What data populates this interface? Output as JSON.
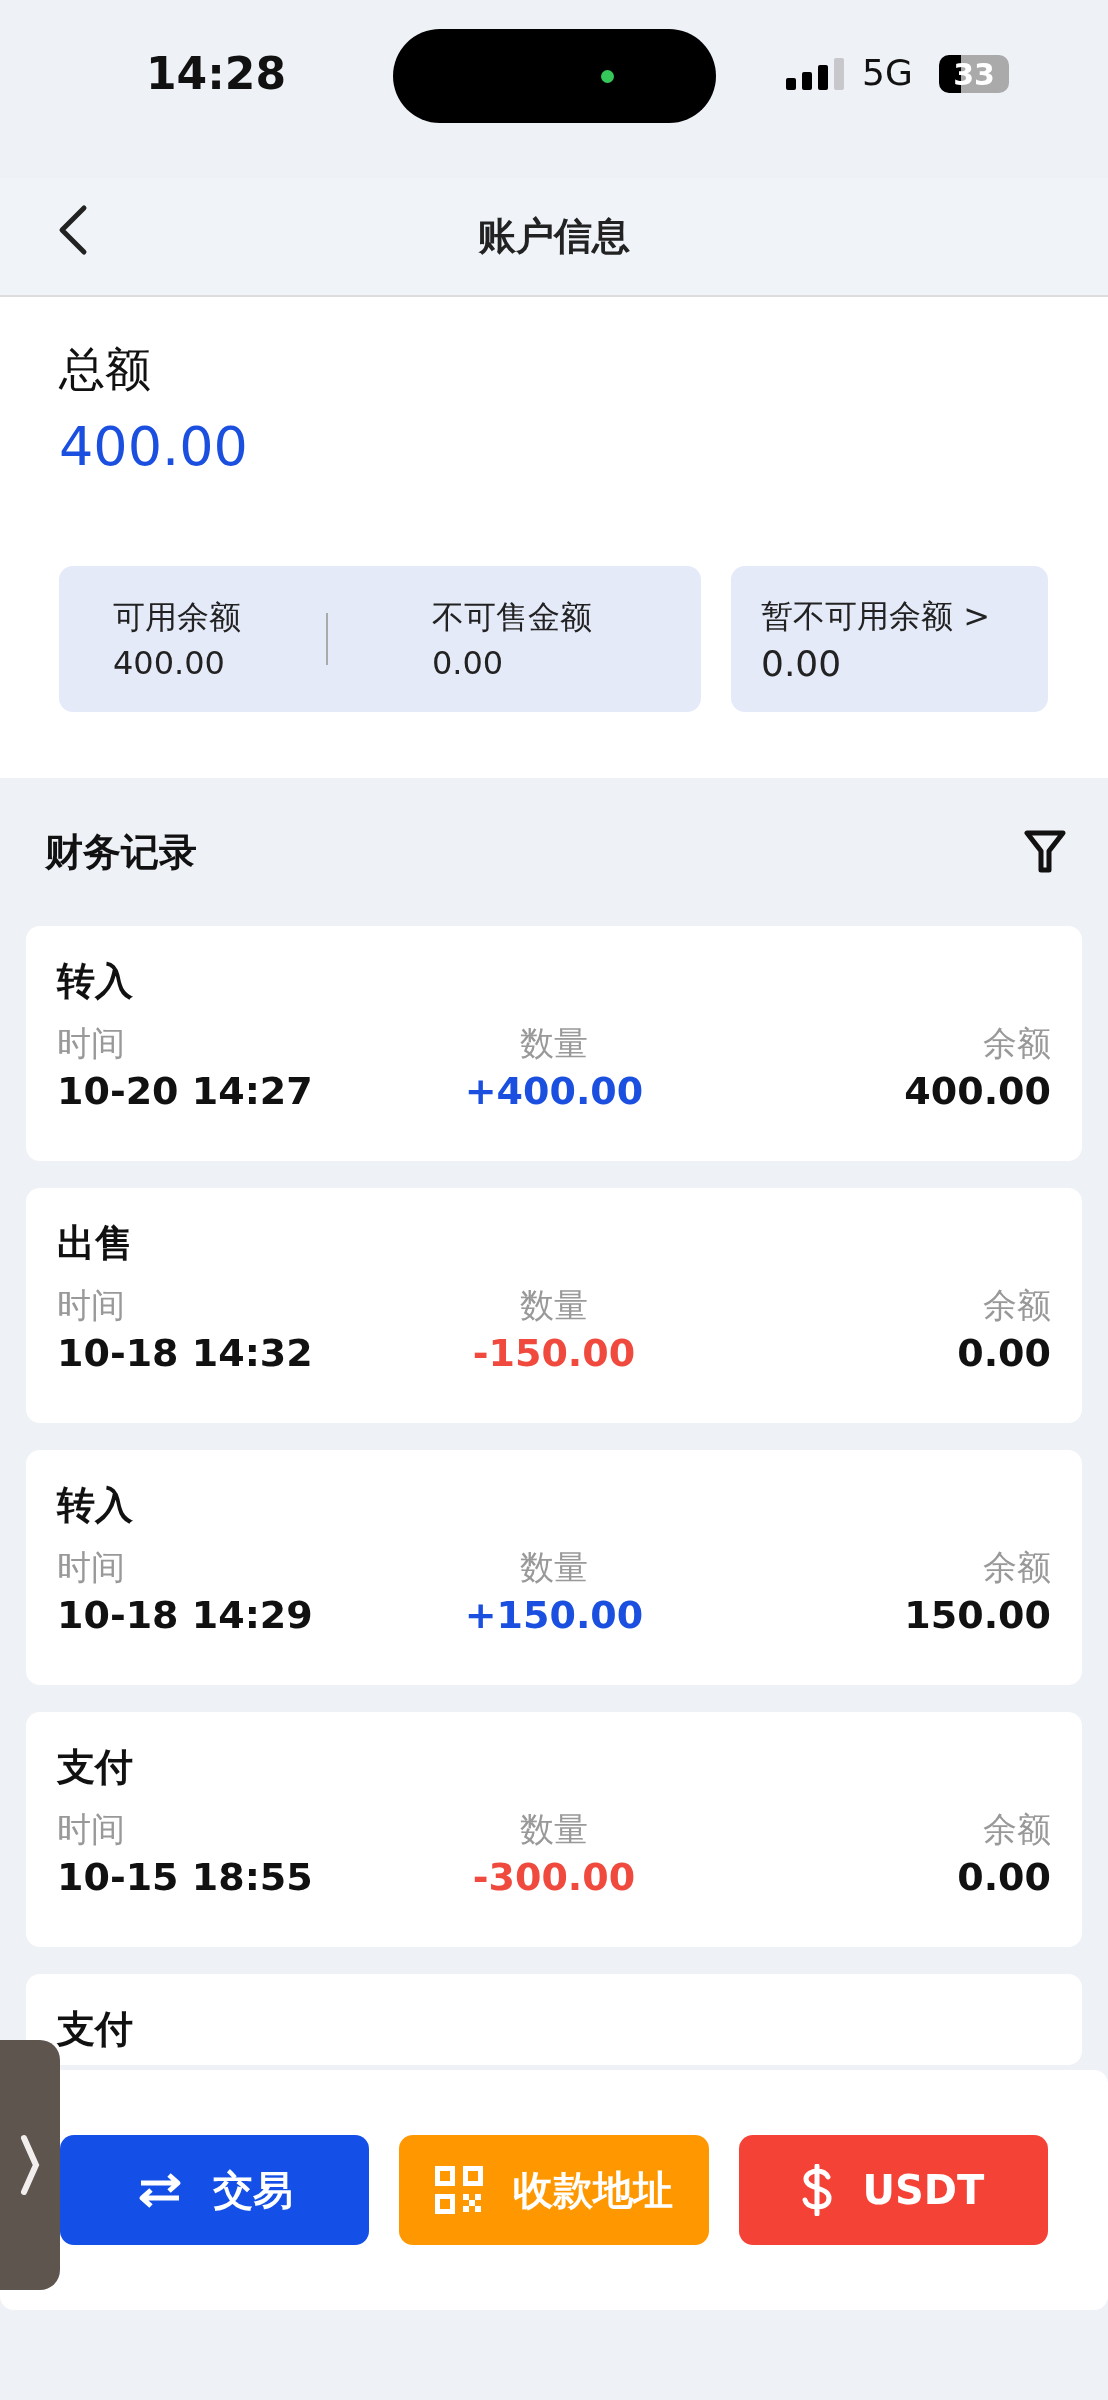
{
  "status_bar": {
    "time": "14:28",
    "network": "5G",
    "battery": "33"
  },
  "nav": {
    "title": "账户信息"
  },
  "summary": {
    "label": "总额",
    "amount": "400.00",
    "tiles": [
      {
        "label": "可用余额",
        "value": "400.00"
      },
      {
        "label": "不可售金额",
        "value": "0.00"
      }
    ],
    "side_tile": {
      "label": "暂不可用余额 >",
      "value": "0.00"
    }
  },
  "records": {
    "title": "财务记录",
    "items": [
      {
        "type": "转入",
        "time_label": "时间",
        "time": "10-20 14:27",
        "amount_label": "数量",
        "amount": "+400.00",
        "kind": "credit",
        "balance_label": "余额",
        "balance": "400.00"
      },
      {
        "type": "出售",
        "time_label": "时间",
        "time": "10-18 14:32",
        "amount_label": "数量",
        "amount": "-150.00",
        "kind": "debit",
        "balance_label": "余额",
        "balance": "0.00"
      },
      {
        "type": "转入",
        "time_label": "时间",
        "time": "10-18 14:29",
        "amount_label": "数量",
        "amount": "+150.00",
        "kind": "credit",
        "balance_label": "余额",
        "balance": "150.00"
      },
      {
        "type": "支付",
        "time_label": "时间",
        "time": "10-15 18:55",
        "amount_label": "数量",
        "amount": "-300.00",
        "kind": "debit",
        "balance_label": "余额",
        "balance": "0.00"
      },
      {
        "type": "支付"
      }
    ]
  },
  "actions": [
    {
      "label": "交易",
      "kind": "trade"
    },
    {
      "label": "收款地址",
      "kind": "address"
    },
    {
      "label": "USDT",
      "kind": "usdt"
    }
  ]
}
